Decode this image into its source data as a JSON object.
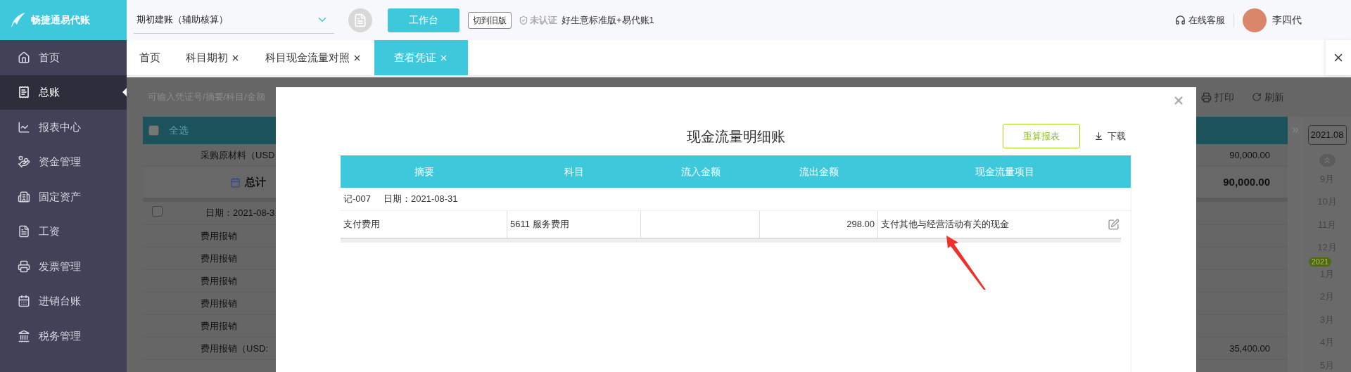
{
  "header": {
    "logo_text": "畅捷通易代账",
    "account_select": "期初建账（辅助核算）",
    "workbench_button": "工作台",
    "old_version_button": "切到旧版",
    "cert_status": "未认证",
    "edition": "好生意标准版+易代账1",
    "support": "在线客服",
    "user": "李四代"
  },
  "sidebar": {
    "items": [
      {
        "label": "首页",
        "selected": false
      },
      {
        "label": "总账",
        "selected": true
      },
      {
        "label": "报表中心",
        "selected": false
      },
      {
        "label": "资金管理",
        "selected": false
      },
      {
        "label": "固定资产",
        "selected": false
      },
      {
        "label": "工资",
        "selected": false
      },
      {
        "label": "发票管理",
        "selected": false
      },
      {
        "label": "进销台账",
        "selected": false
      },
      {
        "label": "税务管理",
        "selected": false
      }
    ]
  },
  "tabs": [
    {
      "label": "首页",
      "closable": false,
      "selected": false
    },
    {
      "label": "科目期初",
      "closable": true,
      "selected": false
    },
    {
      "label": "科目现金流量对照",
      "closable": true,
      "selected": false
    },
    {
      "label": "查看凭证",
      "closable": true,
      "selected": true
    }
  ],
  "background": {
    "search_placeholder": "可输入凭证号/摘要/科目/金额",
    "toolbar": [
      "打印",
      "刷新"
    ],
    "select_all": {
      "label": "全选",
      "checked": false
    },
    "rows": [
      {
        "kind": "item",
        "text": "采购原材料（USD",
        "amount": "90,000.00"
      },
      {
        "kind": "total",
        "text": "总计",
        "amount": "90,000.00"
      },
      {
        "kind": "date",
        "text": "日期：2021-08-3",
        "checked": false
      },
      {
        "kind": "item",
        "text": "费用报销"
      },
      {
        "kind": "item",
        "text": "费用报销"
      },
      {
        "kind": "item",
        "text": "费用报销"
      },
      {
        "kind": "item",
        "text": "费用报销"
      },
      {
        "kind": "item",
        "text": "费用报销"
      },
      {
        "kind": "item",
        "text": "费用报销（USD:",
        "amount": "35,400.00"
      }
    ],
    "period": "2021.08",
    "year_badge": "2021",
    "months": [
      "9月",
      "10月",
      "11月",
      "12月",
      "1月",
      "2月",
      "3月",
      "4月",
      "5月"
    ]
  },
  "modal": {
    "title": "现金流量明细账",
    "recalc_button": "重算报表",
    "download": "下载",
    "columns": [
      "摘要",
      "科目",
      "流入金额",
      "流出金额",
      "现金流量项目"
    ],
    "groups": [
      {
        "voucher": "记-007",
        "date": "日期：2021-08-31",
        "rows": [
          {
            "summary": "支付费用",
            "account": "5611 服务费用",
            "outflow": "298.00",
            "item": "支付其他与经营活动有关的现金"
          }
        ]
      }
    ]
  }
}
